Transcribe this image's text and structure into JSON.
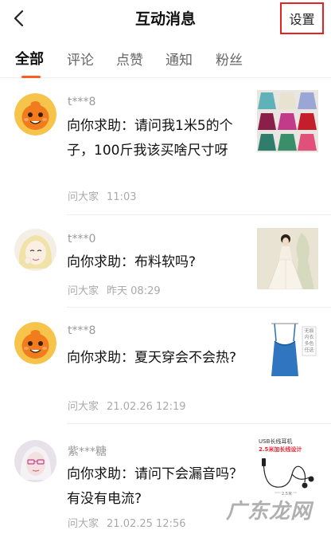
{
  "header": {
    "title": "互动消息",
    "settings_label": "设置"
  },
  "tabs": [
    {
      "label": "全部",
      "active": true
    },
    {
      "label": "评论",
      "active": false
    },
    {
      "label": "点赞",
      "active": false
    },
    {
      "label": "通知",
      "active": false
    },
    {
      "label": "粉丝",
      "active": false
    }
  ],
  "messages": [
    {
      "username": "t***8",
      "text": "向你求助：请问我1米5的个子，100斤我该买啥尺寸呀",
      "source": "问大家",
      "time": "11:03",
      "avatar": "orange-mascot-avatar",
      "thumb": "skirts-grid-thumbnail"
    },
    {
      "username": "t***0",
      "text": "向你求助：布料软吗?",
      "source": "问大家",
      "time": "昨天 08:29",
      "avatar": "anime-girl-avatar",
      "thumb": "dress-model-thumbnail"
    },
    {
      "username": "t***8",
      "text": "向你求助：夏天穿会不会热?",
      "source": "问大家",
      "time": "21.02.26 12:19",
      "avatar": "orange-mascot-avatar",
      "thumb": "blue-camisole-thumbnail"
    },
    {
      "username": "紫***糖",
      "text": "向你求助：请问下会漏音吗？有没有电流?",
      "source": "问大家",
      "time": "21.02.25 12:56",
      "avatar": "portrait-avatar",
      "thumb": "earphones-thumbnail"
    }
  ],
  "thumbnail_text": {
    "camisole_tags": [
      "无痕内衣",
      "多色任选"
    ],
    "earphones_title": "USB长线耳机",
    "earphones_subtitle": "2.5米加长线设计",
    "earphones_length": "2.5米"
  },
  "watermark": "广东龙网",
  "colors": {
    "accent": "#ff5a1f",
    "highlight_box": "#e8231f",
    "text_primary": "#111111",
    "text_secondary": "#999999"
  }
}
